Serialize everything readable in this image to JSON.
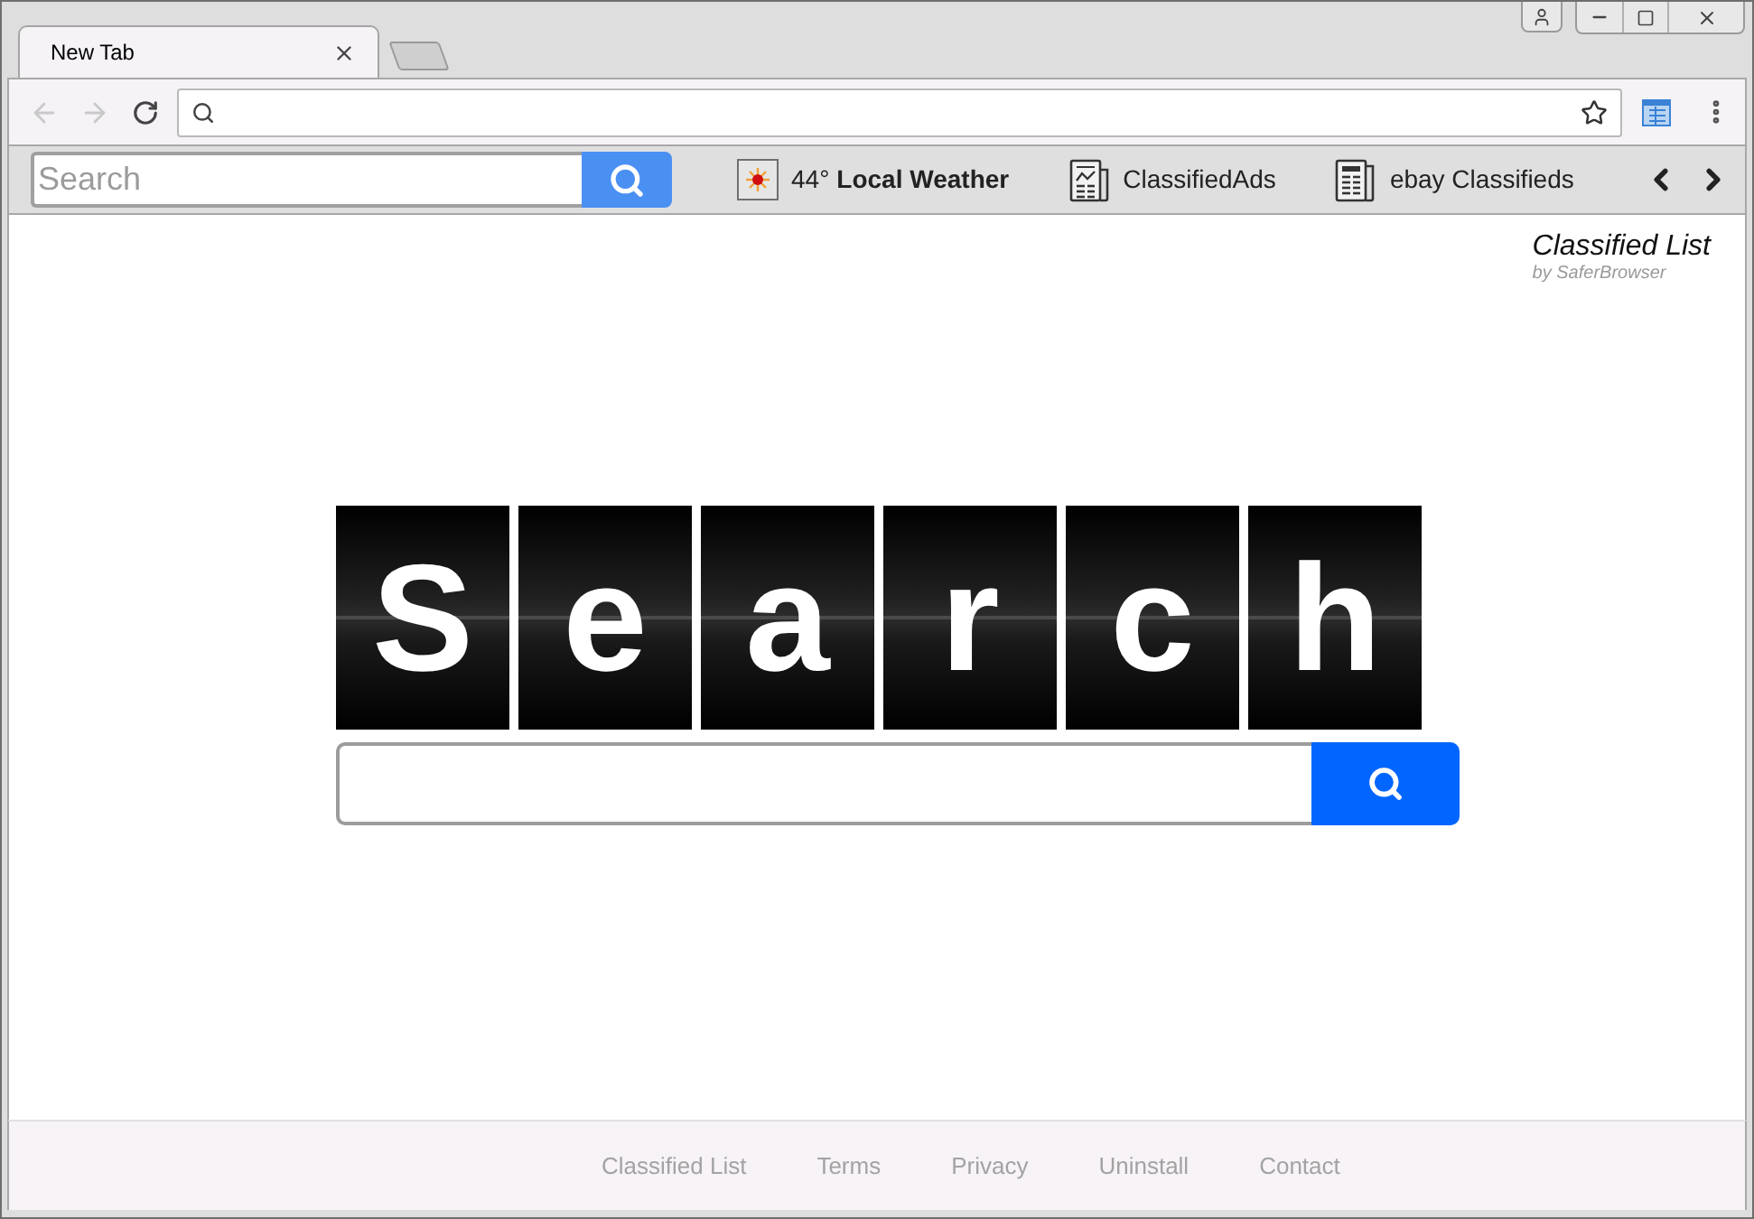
{
  "tabs": [
    {
      "label": "New Tab",
      "selected": true
    }
  ],
  "navigation": {
    "back": {
      "disabled": true
    },
    "forward": {
      "disabled": true
    }
  },
  "extension_bar": {
    "search": {
      "placeholder": "Search"
    },
    "items": [
      {
        "kind": "weather",
        "reading": "44°",
        "label": "Local Weather"
      },
      {
        "kind": "ads",
        "label": "ClassifiedAds"
      },
      {
        "kind": "paper",
        "label": "ebay Classifieds"
      }
    ]
  },
  "brand": {
    "title": "Classified List",
    "byline": "by SaferBrowser"
  },
  "logo": {
    "letters": [
      "S",
      "e",
      "a",
      "r",
      "c",
      "h"
    ]
  },
  "footer": {
    "links": [
      "Classified List",
      "Terms",
      "Privacy",
      "Uninstall",
      "Contact"
    ]
  }
}
